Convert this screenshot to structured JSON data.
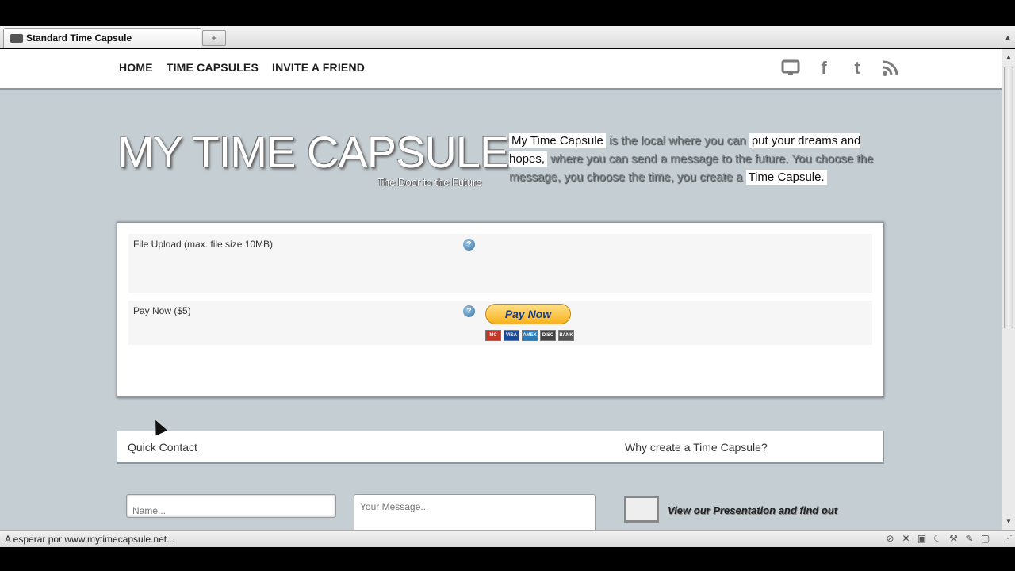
{
  "browser": {
    "tab_title": "Standard Time Capsule",
    "new_tab_label": "+",
    "status_text": "A esperar por www.mytimecapsule.net..."
  },
  "nav": {
    "items": [
      {
        "label": "HOME"
      },
      {
        "label": "TIME CAPSULES"
      },
      {
        "label": "INVITE A FRIEND"
      }
    ],
    "social": [
      {
        "icon": "monitor-icon",
        "glyph": "🖵"
      },
      {
        "icon": "facebook-icon",
        "glyph": "f"
      },
      {
        "icon": "twitter-icon",
        "glyph": "t"
      },
      {
        "icon": "rss-icon",
        "glyph": "≋"
      }
    ]
  },
  "hero": {
    "title": "MY TIME CAPSULE",
    "tagline": "The Door to the Future",
    "intro": {
      "part1": "My Time Capsule",
      "part2": " is the local where you can ",
      "part3": "put your dreams and hopes,",
      "part4": " where you can send a message to the future. You choose the message, you choose the time, you create a ",
      "part5": "Time Capsule."
    }
  },
  "form": {
    "file_upload_label": "File Upload (max. file size 10MB)",
    "pay_now_label": "Pay Now ($5)",
    "paynow_button": "Pay Now",
    "cards": [
      "MC",
      "VISA",
      "AMEX",
      "DISC",
      "BANK"
    ]
  },
  "contact": {
    "quick_contact": "Quick Contact",
    "why_create": "Why create a Time Capsule?",
    "name_placeholder": "Name...",
    "message_placeholder": "Your Message...",
    "presentation_text": "View our Presentation and find out"
  },
  "colors": {
    "page_bg": "#c5ced3",
    "paypal_gold": "#f7b21c",
    "paypal_blue": "#1c3a75"
  }
}
